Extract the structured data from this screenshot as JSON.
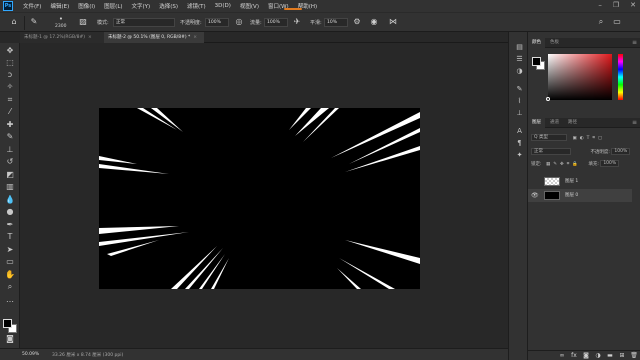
{
  "app": {
    "logo_text": "Ps"
  },
  "menu": {
    "items": [
      "文件(F)",
      "编辑(E)",
      "图像(I)",
      "图层(L)",
      "文字(Y)",
      "选择(S)",
      "滤镜(T)",
      "3D(D)",
      "视图(V)",
      "窗口(W)",
      "帮助(H)"
    ]
  },
  "window_controls": {
    "minimize": "–",
    "restore": "❐",
    "close": "✕"
  },
  "options_bar": {
    "brush_size": "2300",
    "mode_label": "模式:",
    "mode_value": "正常",
    "opacity_label": "不透明度:",
    "opacity_value": "100%",
    "flow_label": "流量:",
    "flow_value": "100%",
    "smoothing_label": "平滑:",
    "smoothing_value": "10%"
  },
  "doc_tabs": [
    {
      "label": "未标题-1 @ 17.2%(RGB/8#)",
      "close": "×",
      "active": false
    },
    {
      "label": "未标题-2 @ 50.1% (图层 0, RGB/8#) *",
      "close": "×",
      "active": true
    }
  ],
  "status": {
    "zoom": "50.09%",
    "doc_info": "33.26 厘米 x 8.74 厘米 (300 ppi)"
  },
  "color_panel": {
    "tabs": [
      "颜色",
      "色板"
    ],
    "menu": "≡"
  },
  "layers_panel": {
    "tabs": [
      "图层",
      "通道",
      "路径"
    ],
    "menu": "≡",
    "kind_filter": "Q 类型",
    "blend_mode": "正常",
    "opacity_label": "不透明度:",
    "opacity_value": "100%",
    "lock_label": "锁定:",
    "fill_label": "填充:",
    "fill_value": "100%",
    "layers": [
      {
        "name": "图层 1",
        "visible": false,
        "thumb": "transparent",
        "selected": false
      },
      {
        "name": "图层 0",
        "visible": true,
        "thumb": "black",
        "selected": true
      }
    ]
  },
  "colors": {
    "foreground": "#000000",
    "background": "#ffffff",
    "accent": "#31a8ff",
    "menu_highlight": "#e07a1f"
  }
}
